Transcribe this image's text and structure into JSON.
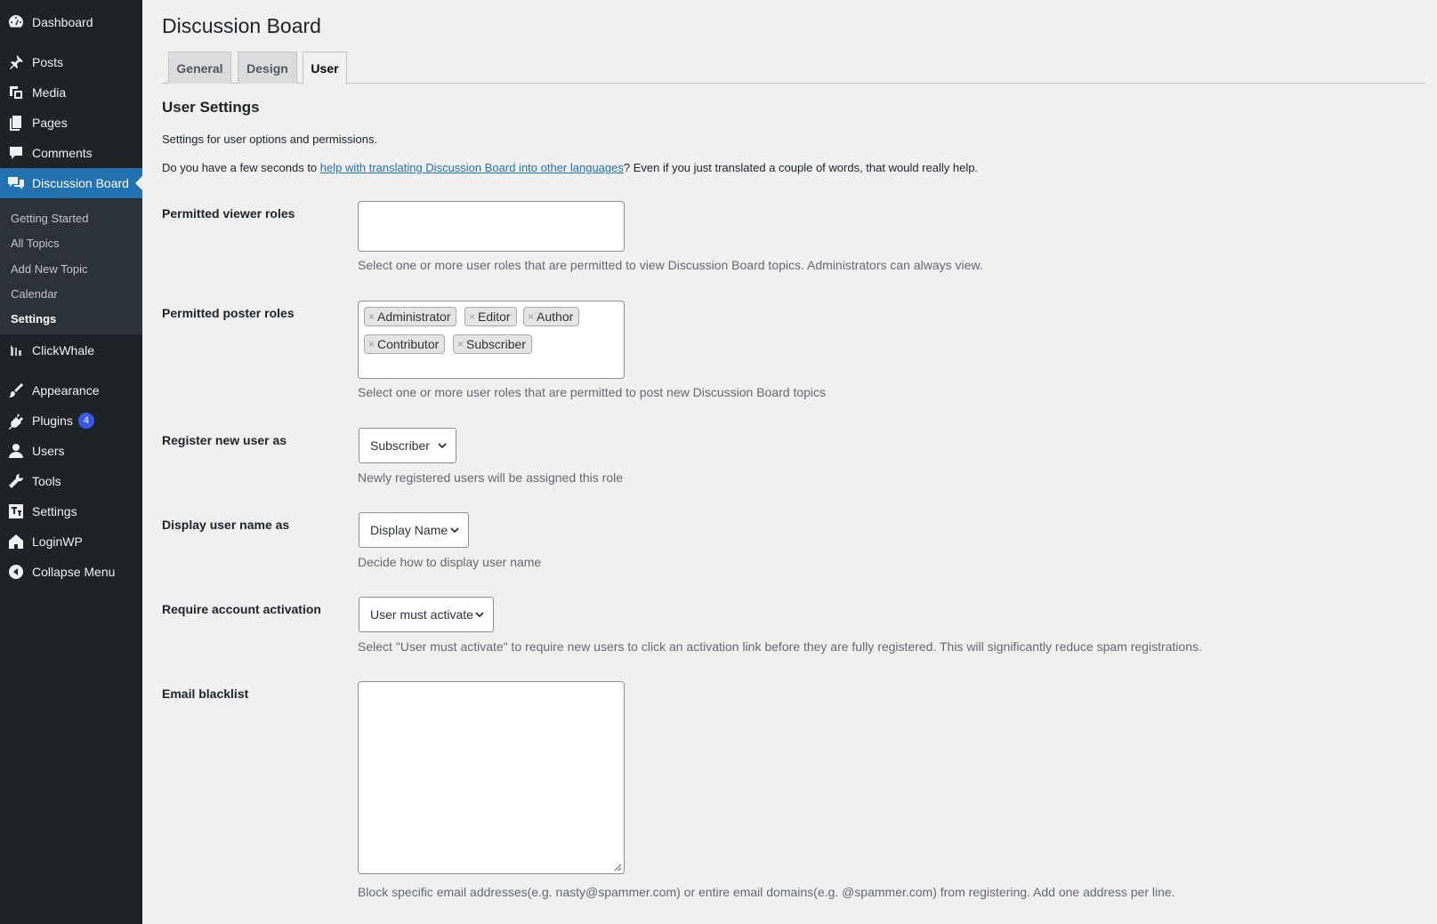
{
  "sidebar": {
    "items": [
      {
        "label": "Dashboard",
        "icon": "dashboard-icon"
      },
      {
        "label": "Posts",
        "icon": "pushpin-icon"
      },
      {
        "label": "Media",
        "icon": "media-icon"
      },
      {
        "label": "Pages",
        "icon": "pages-icon"
      },
      {
        "label": "Comments",
        "icon": "comments-icon"
      },
      {
        "label": "Discussion Board",
        "icon": "discussion-icon"
      },
      {
        "label": "ClickWhale",
        "icon": "clickwhale-icon"
      },
      {
        "label": "Appearance",
        "icon": "brush-icon"
      },
      {
        "label": "Plugins",
        "icon": "plugin-icon",
        "badge": "4"
      },
      {
        "label": "Users",
        "icon": "user-icon"
      },
      {
        "label": "Tools",
        "icon": "wrench-icon"
      },
      {
        "label": "Settings",
        "icon": "settings-icon"
      },
      {
        "label": "LoginWP",
        "icon": "home-icon"
      },
      {
        "label": "Collapse Menu",
        "icon": "collapse-icon"
      }
    ],
    "submenu": [
      "Getting Started",
      "All Topics",
      "Add New Topic",
      "Calendar",
      "Settings"
    ]
  },
  "page": {
    "title": "Discussion Board",
    "tabs": [
      "General",
      "Design",
      "User"
    ],
    "active_tab": "User"
  },
  "section": {
    "title": "User Settings",
    "description": "Settings for user options and permissions.",
    "translate_prefix": "Do you have a few seconds to ",
    "translate_link": "help with translating Discussion Board into other languages",
    "translate_suffix": "? Even if you just translated a couple of words, that would really help."
  },
  "fields": {
    "viewer_roles": {
      "label": "Permitted viewer roles",
      "description": "Select one or more user roles that are permitted to view Discussion Board topics. Administrators can always view."
    },
    "poster_roles": {
      "label": "Permitted poster roles",
      "chips": [
        "Administrator",
        "Editor",
        "Author",
        "Contributor",
        "Subscriber"
      ],
      "chip_remove": "×",
      "description": "Select one or more user roles that are permitted to post new Discussion Board topics"
    },
    "register_role": {
      "label": "Register new user as",
      "value": "Subscriber",
      "description": "Newly registered users will be assigned this role"
    },
    "display_name": {
      "label": "Display user name as",
      "value": "Display Name",
      "description": "Decide how to display user name"
    },
    "activation": {
      "label": "Require account activation",
      "value": "User must activate",
      "description": "Select \"User must activate\" to require new users to click an activation link before they are fully registered. This will significantly reduce spam registrations."
    },
    "email_blacklist": {
      "label": "Email blacklist",
      "value": "",
      "description": "Block specific email addresses(e.g. nasty@spammer.com) or entire email domains(e.g. @spammer.com) from registering. Add one address per line."
    }
  },
  "colors": {
    "sidebar_bg": "#1d2327",
    "submenu_bg": "#2c3338",
    "accent": "#2271b1",
    "badge": "#3858e9",
    "page_bg": "#f0f0f1"
  }
}
